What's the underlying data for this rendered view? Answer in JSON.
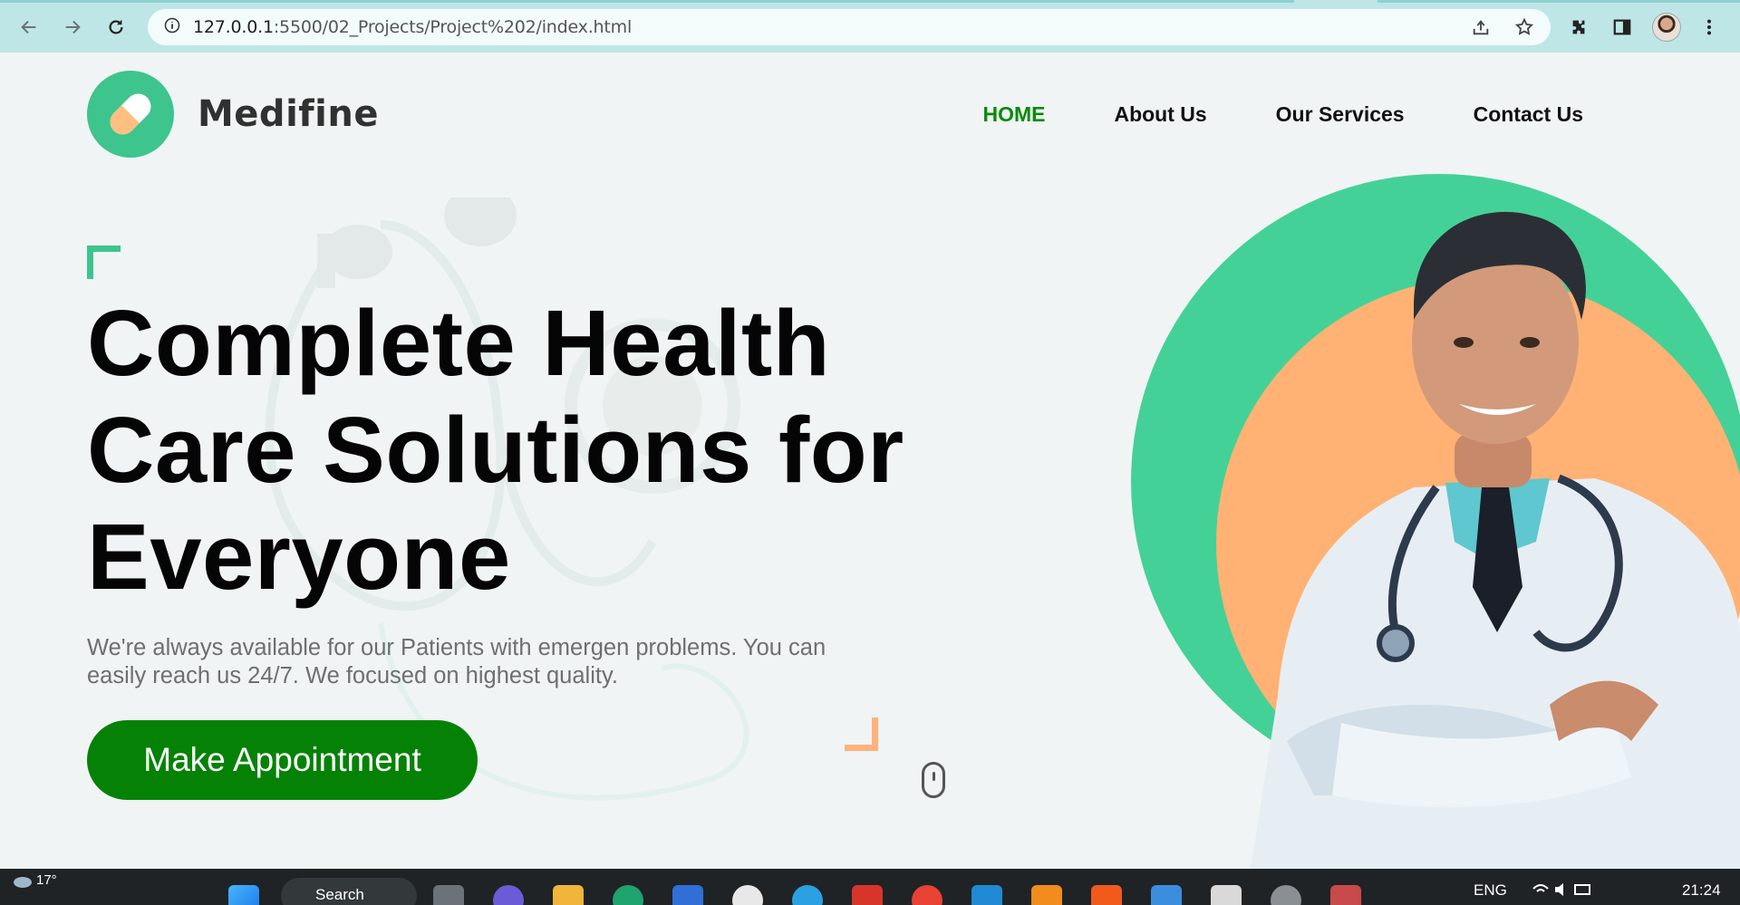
{
  "browser": {
    "url_host": "127.0.0.1",
    "url_path": ":5500/02_Projects/Project%202/index.html"
  },
  "site": {
    "brand": "Medifine",
    "nav": [
      "HOME",
      "About Us",
      "Our Services",
      "Contact Us"
    ],
    "headline": "Complete Health Care Solutions for Everyone",
    "subtext": "We're always available for our Patients with emergen problems. You can easily reach us 24/7. We focused on highest quality.",
    "cta": "Make Appointment"
  },
  "colors": {
    "brand_green": "#3ec48d",
    "active_nav": "#0a8a0a",
    "cta_bg": "#058205",
    "accent_orange": "#ffb27a"
  },
  "taskbar": {
    "temperature": "17°",
    "search": "Search",
    "lang": "ENG",
    "time": "21:24"
  }
}
